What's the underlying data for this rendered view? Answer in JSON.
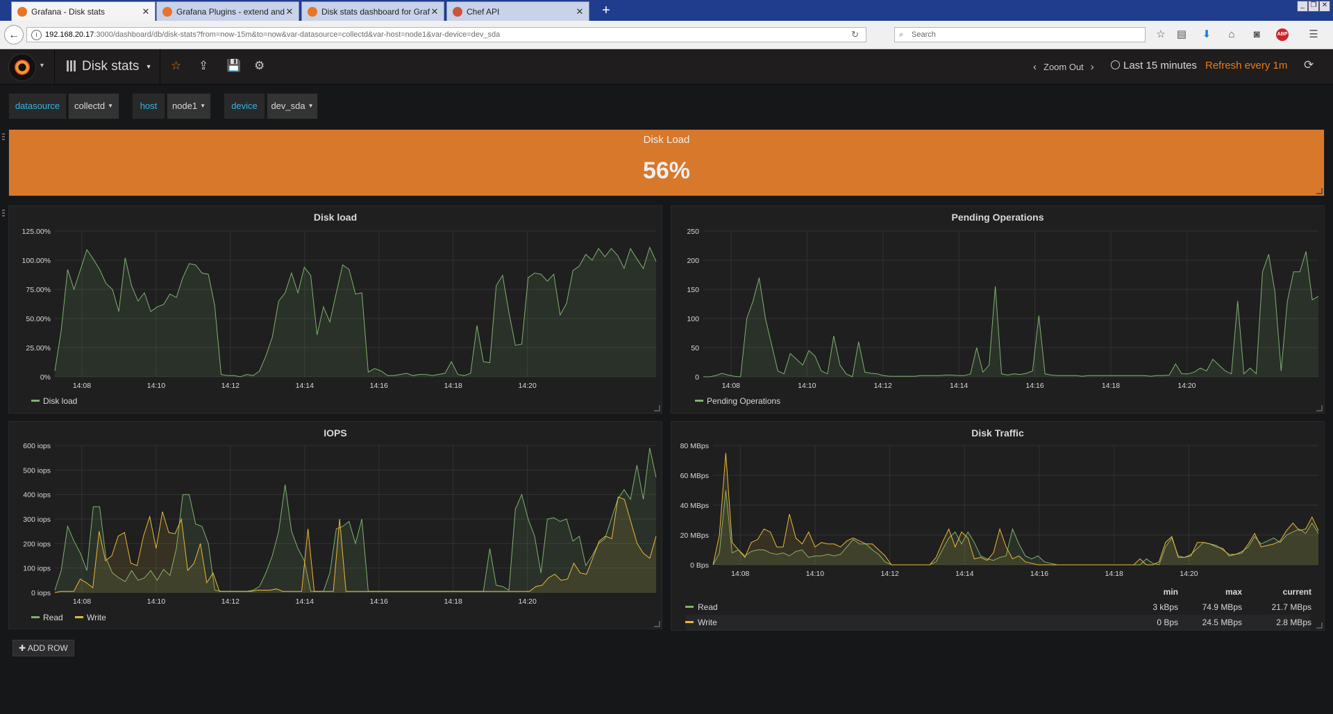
{
  "browser": {
    "tabs": [
      {
        "title": "Grafana - Disk stats",
        "active": true,
        "icon": "grafana-icon"
      },
      {
        "title": "Grafana Plugins - extend and ...",
        "active": false,
        "icon": "grafana-icon"
      },
      {
        "title": "Disk stats dashboard for Graf...",
        "active": false,
        "icon": "grafana-icon"
      },
      {
        "title": "Chef API",
        "active": false,
        "icon": "chef-icon"
      }
    ],
    "new_tab_label": "+",
    "url_host": "192.168.20.17",
    "url_path": ":3000/dashboard/db/disk-stats?from=now-15m&to=now&var-datasource=collectd&var-host=node1&var-device=dev_sda",
    "search_placeholder": "Search",
    "window_controls": [
      "_",
      "❐",
      "✕"
    ]
  },
  "grafana": {
    "dashboard_title": "Disk stats",
    "zoom_out_label": "Zoom Out",
    "time_range": "Last 15 minutes",
    "refresh_label": "Refresh every 1m",
    "accent_color": "#eb7b18"
  },
  "variables": [
    {
      "label": "datasource",
      "value": "collectd"
    },
    {
      "label": "host",
      "value": "node1"
    },
    {
      "label": "device",
      "value": "dev_sda"
    }
  ],
  "singlestat": {
    "title": "Disk Load",
    "value": "56%",
    "background": "#d8782b"
  },
  "add_row_label": "ADD ROW",
  "chart_data": [
    {
      "type": "area",
      "title": "Disk load",
      "x": [
        "14:08",
        "14:10",
        "14:12",
        "14:14",
        "14:16",
        "14:18",
        "14:20"
      ],
      "y_ticks": [
        "0%",
        "25.00%",
        "50.00%",
        "75.00%",
        "100.00%",
        "125.00%"
      ],
      "ylim": [
        0,
        125
      ],
      "series": [
        {
          "name": "Disk load",
          "color": "#7eb26d",
          "values": [
            5,
            40,
            92,
            75,
            92,
            109,
            101,
            92,
            80,
            75,
            56,
            102,
            78,
            65,
            72,
            56,
            60,
            62,
            71,
            68,
            85,
            97,
            96,
            89,
            88,
            61,
            2,
            1,
            1,
            0,
            2,
            1,
            5,
            18,
            34,
            65,
            72,
            89,
            72,
            94,
            87,
            36,
            60,
            47,
            72,
            96,
            92,
            71,
            72,
            4,
            7,
            5,
            1,
            1,
            2,
            3,
            1,
            2,
            2,
            1,
            2,
            3,
            13,
            2,
            1,
            3,
            44,
            13,
            12,
            78,
            87,
            55,
            27,
            28,
            85,
            89,
            88,
            82,
            88,
            53,
            63,
            91,
            95,
            105,
            100,
            110,
            103,
            110,
            104,
            93,
            110,
            101,
            93,
            111,
            99
          ]
        }
      ]
    },
    {
      "type": "area",
      "title": "Pending Operations",
      "x": [
        "14:08",
        "14:10",
        "14:12",
        "14:14",
        "14:16",
        "14:18",
        "14:20"
      ],
      "y_ticks": [
        "0",
        "50",
        "100",
        "150",
        "200",
        "250"
      ],
      "ylim": [
        0,
        250
      ],
      "series": [
        {
          "name": "Pending Operations",
          "color": "#7eb26d",
          "values": [
            0,
            0,
            2,
            6,
            3,
            1,
            0,
            100,
            130,
            170,
            100,
            55,
            10,
            5,
            40,
            30,
            20,
            45,
            35,
            10,
            5,
            70,
            20,
            5,
            0,
            60,
            8,
            6,
            5,
            2,
            1,
            1,
            1,
            1,
            1,
            2,
            2,
            2,
            2,
            3,
            3,
            2,
            2,
            5,
            50,
            8,
            20,
            155,
            5,
            3,
            5,
            4,
            6,
            10,
            105,
            5,
            3,
            2,
            2,
            2,
            2,
            1,
            2,
            2,
            2,
            2,
            2,
            2,
            2,
            2,
            2,
            2,
            1,
            2,
            2,
            3,
            22,
            5,
            5,
            8,
            15,
            10,
            30,
            20,
            10,
            5,
            130,
            5,
            15,
            5,
            180,
            210,
            145,
            10,
            130,
            180,
            180,
            215,
            132,
            138
          ]
        }
      ]
    },
    {
      "type": "area",
      "title": "IOPS",
      "x": [
        "14:08",
        "14:10",
        "14:12",
        "14:14",
        "14:16",
        "14:18",
        "14:20"
      ],
      "y_ticks": [
        "0 iops",
        "100 iops",
        "200 iops",
        "300 iops",
        "400 iops",
        "500 iops",
        "600 iops"
      ],
      "ylim": [
        0,
        600
      ],
      "series": [
        {
          "name": "Read",
          "color": "#7eb26d",
          "values": [
            10,
            90,
            270,
            210,
            160,
            90,
            350,
            350,
            140,
            80,
            60,
            45,
            90,
            50,
            60,
            90,
            50,
            95,
            70,
            180,
            400,
            400,
            280,
            270,
            200,
            10,
            5,
            5,
            5,
            5,
            5,
            10,
            25,
            80,
            150,
            250,
            440,
            250,
            180,
            130,
            5,
            5,
            5,
            80,
            260,
            270,
            290,
            200,
            300,
            5,
            5,
            5,
            5,
            5,
            5,
            5,
            5,
            5,
            5,
            5,
            5,
            5,
            5,
            5,
            5,
            5,
            5,
            5,
            180,
            30,
            25,
            10,
            340,
            400,
            300,
            230,
            80,
            300,
            305,
            290,
            300,
            210,
            230,
            110,
            150,
            200,
            220,
            300,
            380,
            420,
            380,
            520,
            380,
            590,
            470
          ]
        },
        {
          "name": "Write",
          "color": "#eab839",
          "values": [
            0,
            5,
            5,
            5,
            55,
            40,
            20,
            250,
            130,
            150,
            230,
            245,
            120,
            110,
            230,
            310,
            180,
            330,
            245,
            240,
            300,
            90,
            120,
            200,
            40,
            80,
            5,
            5,
            5,
            5,
            5,
            5,
            10,
            10,
            10,
            15,
            5,
            5,
            5,
            5,
            260,
            5,
            5,
            5,
            5,
            300,
            5,
            5,
            5,
            5,
            5,
            5,
            5,
            5,
            5,
            5,
            5,
            5,
            5,
            5,
            5,
            5,
            5,
            5,
            5,
            5,
            5,
            5,
            5,
            5,
            5,
            5,
            5,
            5,
            5,
            5,
            25,
            30,
            60,
            75,
            50,
            55,
            120,
            80,
            75,
            140,
            210,
            230,
            220,
            390,
            380,
            290,
            200,
            160,
            140,
            230
          ]
        }
      ]
    },
    {
      "type": "area",
      "title": "Disk Traffic",
      "x": [
        "14:08",
        "14:10",
        "14:12",
        "14:14",
        "14:16",
        "14:18",
        "14:20"
      ],
      "y_ticks": [
        "0 Bps",
        "20 MBps",
        "40 MBps",
        "60 MBps",
        "80 MBps"
      ],
      "ylim": [
        0,
        80
      ],
      "series": [
        {
          "name": "Read",
          "color": "#7eb26d",
          "min": "3 kBps",
          "max": "74.9 MBps",
          "current": "21.7 MBps",
          "values": [
            0,
            8,
            50,
            8,
            10,
            6,
            9,
            10,
            10,
            8,
            7,
            8,
            6,
            9,
            10,
            5,
            6,
            6,
            7,
            6,
            7,
            12,
            17,
            14,
            14,
            10,
            7,
            2,
            0,
            0,
            0,
            0,
            0,
            0,
            0,
            2,
            10,
            18,
            22,
            14,
            22,
            15,
            6,
            4,
            3,
            5,
            6,
            24,
            14,
            6,
            4,
            6,
            2,
            1,
            0,
            0,
            0,
            0,
            0,
            0,
            0,
            0,
            0,
            0,
            0,
            0,
            0,
            0,
            4,
            1,
            0,
            12,
            18,
            6,
            5,
            7,
            11,
            15,
            14,
            13,
            10,
            7,
            7,
            9,
            12,
            19,
            14,
            16,
            18,
            15,
            20,
            22,
            24,
            21,
            28,
            21
          ]
        },
        {
          "name": "Write",
          "color": "#eab839",
          "min": "0 Bps",
          "max": "24.5 MBps",
          "current": "2.8 MBps",
          "values": [
            0,
            20,
            75,
            15,
            10,
            5,
            15,
            17,
            24,
            22,
            12,
            12,
            34,
            18,
            14,
            22,
            12,
            15,
            14,
            14,
            12,
            16,
            18,
            16,
            14,
            14,
            10,
            6,
            0,
            0,
            0,
            0,
            0,
            0,
            0,
            5,
            15,
            24,
            12,
            22,
            18,
            4,
            5,
            3,
            8,
            24,
            12,
            4,
            6,
            2,
            1,
            0,
            0,
            0,
            0,
            0,
            0,
            0,
            0,
            0,
            0,
            0,
            0,
            0,
            0,
            0,
            0,
            4,
            0,
            0,
            2,
            15,
            19,
            5,
            5,
            6,
            15,
            15,
            14,
            12,
            11,
            6,
            7,
            8,
            14,
            21,
            12,
            13,
            14,
            16,
            23,
            28,
            23,
            24,
            32,
            23
          ]
        }
      ]
    }
  ]
}
